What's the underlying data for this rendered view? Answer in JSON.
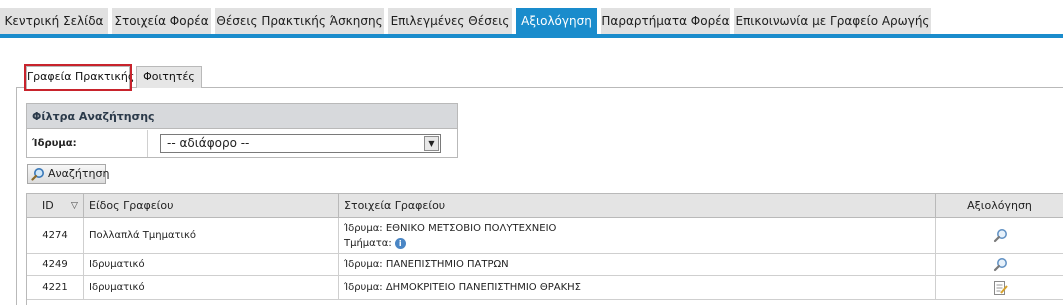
{
  "top_nav": {
    "tabs": [
      {
        "label": "Κεντρική Σελίδα",
        "active": false
      },
      {
        "label": "Στοιχεία Φορέα",
        "active": false
      },
      {
        "label": "Θέσεις Πρακτικής Άσκησης",
        "active": false
      },
      {
        "label": "Επιλεγμένες Θέσεις",
        "active": false
      },
      {
        "label": "Αξιολόγηση",
        "active": true
      },
      {
        "label": "Παραρτήματα Φορέα",
        "active": false
      },
      {
        "label": "Επικοινωνία με Γραφείο Αρωγής",
        "active": false
      }
    ]
  },
  "sub_tabs": [
    {
      "label": "Γραφεία Πρακτικής",
      "active": true
    },
    {
      "label": "Φοιτητές",
      "active": false
    }
  ],
  "filter": {
    "title": "Φίλτρα Αναζήτησης",
    "institution_label": "Ίδρυμα:",
    "institution_value": "-- αδιάφορο --"
  },
  "search_button": {
    "label": "Αναζήτηση",
    "icon": "search-icon"
  },
  "grid": {
    "columns": [
      "ID",
      "Είδος Γραφείου",
      "Στοιχεία Γραφείου",
      "Αξιολόγηση"
    ],
    "rows": [
      {
        "id": "4274",
        "type": "Πολλαπλά Τμηματικό",
        "info_line1": "Ίδρυμα: ΕΘΝΙΚΟ ΜΕΤΣΟΒΙΟ ΠΟΛΥΤΕΧΝΕΙΟ",
        "info_line2": "Τμήματα:",
        "eval_icon": "magnifier-icon"
      },
      {
        "id": "4249",
        "type": "Ιδρυματικό",
        "info_line1": "Ίδρυμα: ΠΑΝΕΠΙΣΤΗΜΙΟ ΠΑΤΡΩΝ",
        "eval_icon": "magnifier-icon"
      },
      {
        "id": "4221",
        "type": "Ιδρυματικό",
        "info_line1": "Ίδρυμα: ΔΗΜΟΚΡΙΤΕΙΟ ΠΑΝΕΠΙΣΤΗΜΙΟ ΘΡΑΚΗΣ",
        "eval_icon": "edit-form-icon"
      }
    ]
  },
  "colors": {
    "accent": "#1a8ccc",
    "highlight": "#c8232c",
    "header_bg": "#e4e4e4"
  }
}
